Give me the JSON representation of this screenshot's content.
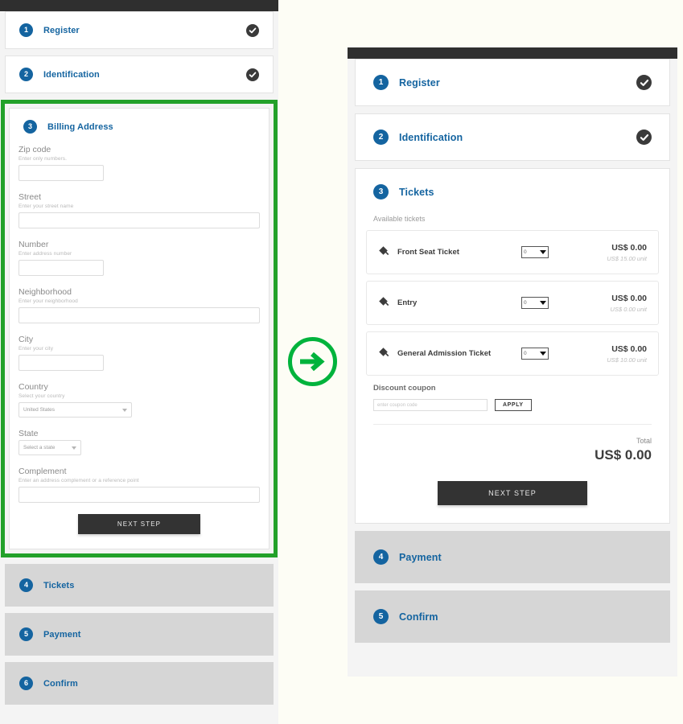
{
  "theme": {
    "page_bg": "#fdfdf5",
    "panel_bg": "#f4f4f4",
    "accent_blue": "#1464a0",
    "highlight_green": "#23a12a",
    "dark_button": "#333333",
    "collapsed_gray": "#d6d6d6"
  },
  "left_panel": {
    "steps": [
      {
        "number": "1",
        "label": "Register",
        "state": "done"
      },
      {
        "number": "2",
        "label": "Identification",
        "state": "done"
      },
      {
        "number": "3",
        "label": "Billing Address",
        "state": "active"
      },
      {
        "number": "4",
        "label": "Tickets",
        "state": "collapsed"
      },
      {
        "number": "5",
        "label": "Payment",
        "state": "collapsed"
      },
      {
        "number": "6",
        "label": "Confirm",
        "state": "collapsed"
      }
    ],
    "form": {
      "fields": [
        {
          "label": "Zip code",
          "hint": "Enter only numbers.",
          "type": "text",
          "value": "",
          "size": "short"
        },
        {
          "label": "Street",
          "hint": "Enter your street name",
          "type": "text",
          "value": "",
          "size": "full"
        },
        {
          "label": "Number",
          "hint": "Enter address number",
          "type": "text",
          "value": "",
          "size": "short"
        },
        {
          "label": "Neighborhood",
          "hint": "Enter your neighborhood",
          "type": "text",
          "value": "",
          "size": "full"
        },
        {
          "label": "City",
          "hint": "Enter your city",
          "type": "text",
          "value": "",
          "size": "short"
        },
        {
          "label": "Country",
          "hint": "Select your country",
          "type": "select",
          "value": "United States",
          "size": "country"
        },
        {
          "label": "State",
          "hint": "",
          "type": "select",
          "value": "Select a state",
          "size": "state"
        },
        {
          "label": "Complement",
          "hint": "Enter an address complement or a reference point",
          "type": "text",
          "value": "",
          "size": "full"
        }
      ],
      "next_step_label": "NEXT STEP"
    }
  },
  "arrow": {
    "icon": "arrow-right-circle-icon",
    "color": "#00b33c"
  },
  "right_panel": {
    "steps": [
      {
        "number": "1",
        "label": "Register",
        "state": "done"
      },
      {
        "number": "2",
        "label": "Identification",
        "state": "done"
      },
      {
        "number": "3",
        "label": "Tickets",
        "state": "active"
      },
      {
        "number": "4",
        "label": "Payment",
        "state": "collapsed"
      },
      {
        "number": "5",
        "label": "Confirm",
        "state": "collapsed"
      }
    ],
    "tickets": {
      "available_label": "Available tickets",
      "items": [
        {
          "name": "Front Seat Ticket",
          "qty": "0",
          "line_total": "US$ 0.00",
          "unit_price": "US$ 15.00 unit"
        },
        {
          "name": "Entry",
          "qty": "0",
          "line_total": "US$ 0.00",
          "unit_price": "US$ 0.00 unit"
        },
        {
          "name": "General Admission Ticket",
          "qty": "0",
          "line_total": "US$ 0.00",
          "unit_price": "US$ 10.00 unit"
        }
      ],
      "coupon": {
        "label": "Discount coupon",
        "placeholder": "enter coupon code",
        "value": "",
        "apply_label": "APPLY"
      },
      "total_label": "Total",
      "total_value": "US$ 0.00",
      "next_step_label": "NEXT STEP"
    }
  }
}
